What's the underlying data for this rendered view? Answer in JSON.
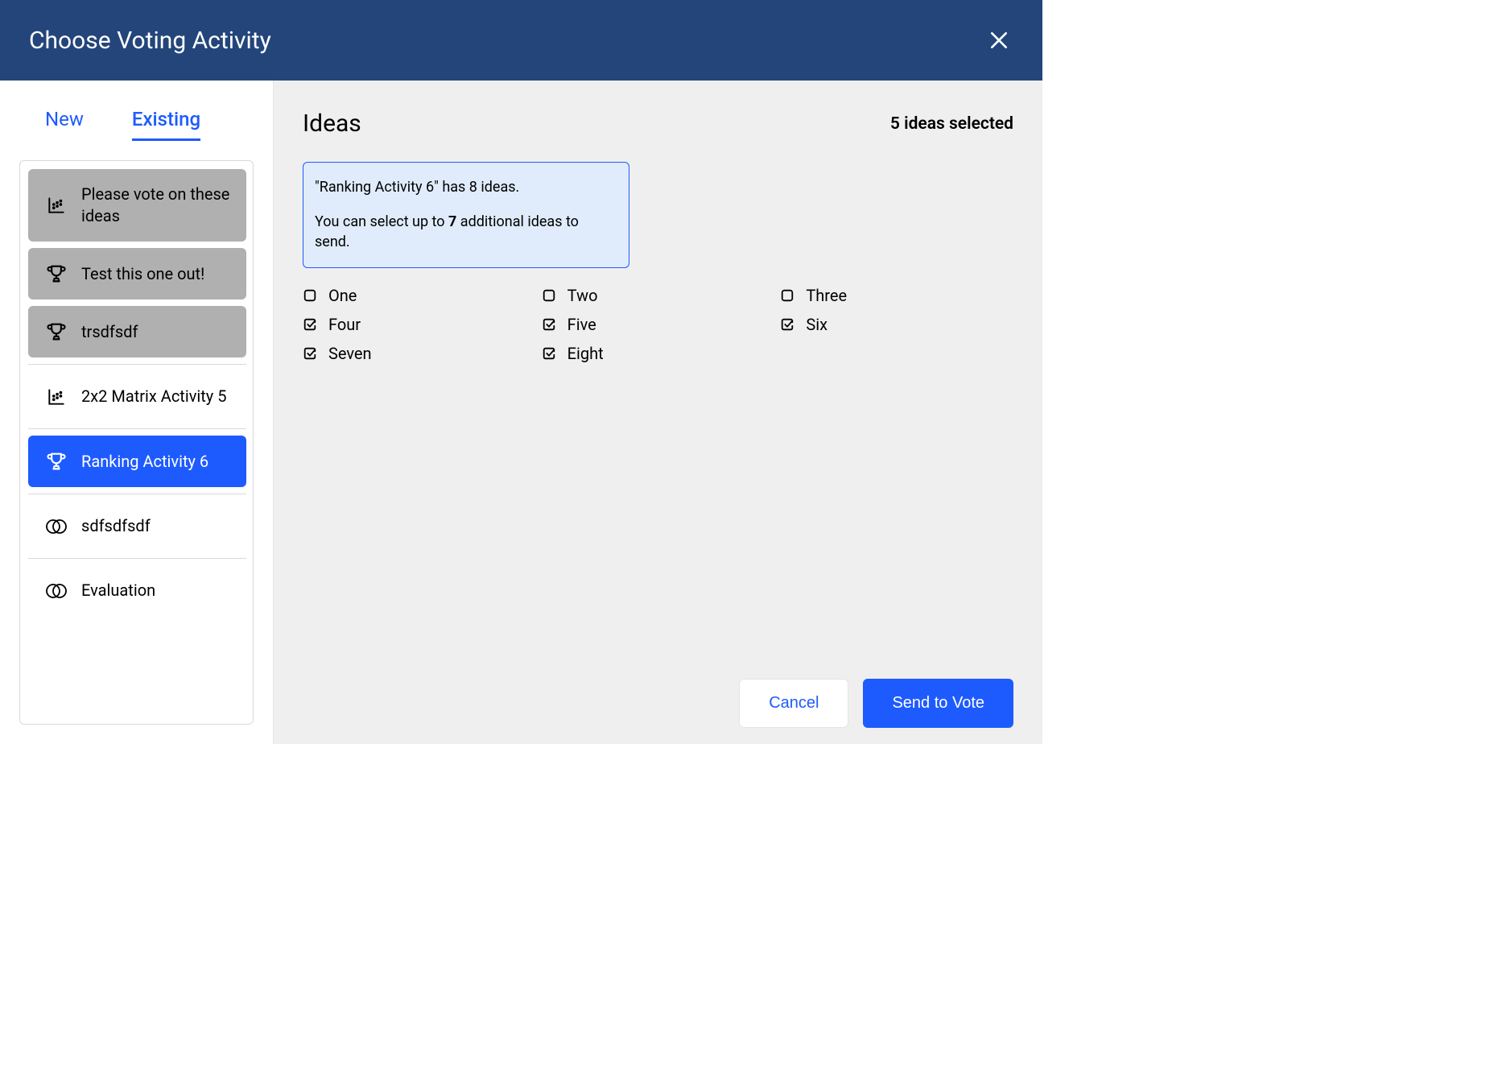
{
  "header": {
    "title": "Choose Voting Activity"
  },
  "tabs": {
    "new": "New",
    "existing": "Existing"
  },
  "activities": [
    {
      "label": "Please vote on these ideas",
      "icon": "matrix",
      "style": "gray"
    },
    {
      "label": "Test this one out!",
      "icon": "trophy",
      "style": "gray"
    },
    {
      "label": "trsdfsdf",
      "icon": "trophy",
      "style": "gray"
    },
    {
      "label": "2x2 Matrix Activity 5",
      "icon": "matrix",
      "style": "white"
    },
    {
      "label": "Ranking Activity 6",
      "icon": "trophy",
      "style": "selected"
    },
    {
      "label": "sdfsdfsdf",
      "icon": "venn",
      "style": "white"
    },
    {
      "label": "Evaluation",
      "icon": "venn",
      "style": "white"
    }
  ],
  "main": {
    "title": "Ideas",
    "selected_count_text": "5 ideas selected",
    "info_line1": "\"Ranking Activity 6\" has 8 ideas.",
    "info_line2_prefix": "You can select up to ",
    "info_line2_count": "7",
    "info_line2_suffix": " additional ideas to send."
  },
  "ideas": [
    {
      "label": "One",
      "checked": false
    },
    {
      "label": "Two",
      "checked": false
    },
    {
      "label": "Three",
      "checked": false
    },
    {
      "label": "Four",
      "checked": true
    },
    {
      "label": "Five",
      "checked": true
    },
    {
      "label": "Six",
      "checked": true
    },
    {
      "label": "Seven",
      "checked": true
    },
    {
      "label": "Eight",
      "checked": true
    }
  ],
  "footer": {
    "cancel": "Cancel",
    "submit": "Send to Vote"
  }
}
